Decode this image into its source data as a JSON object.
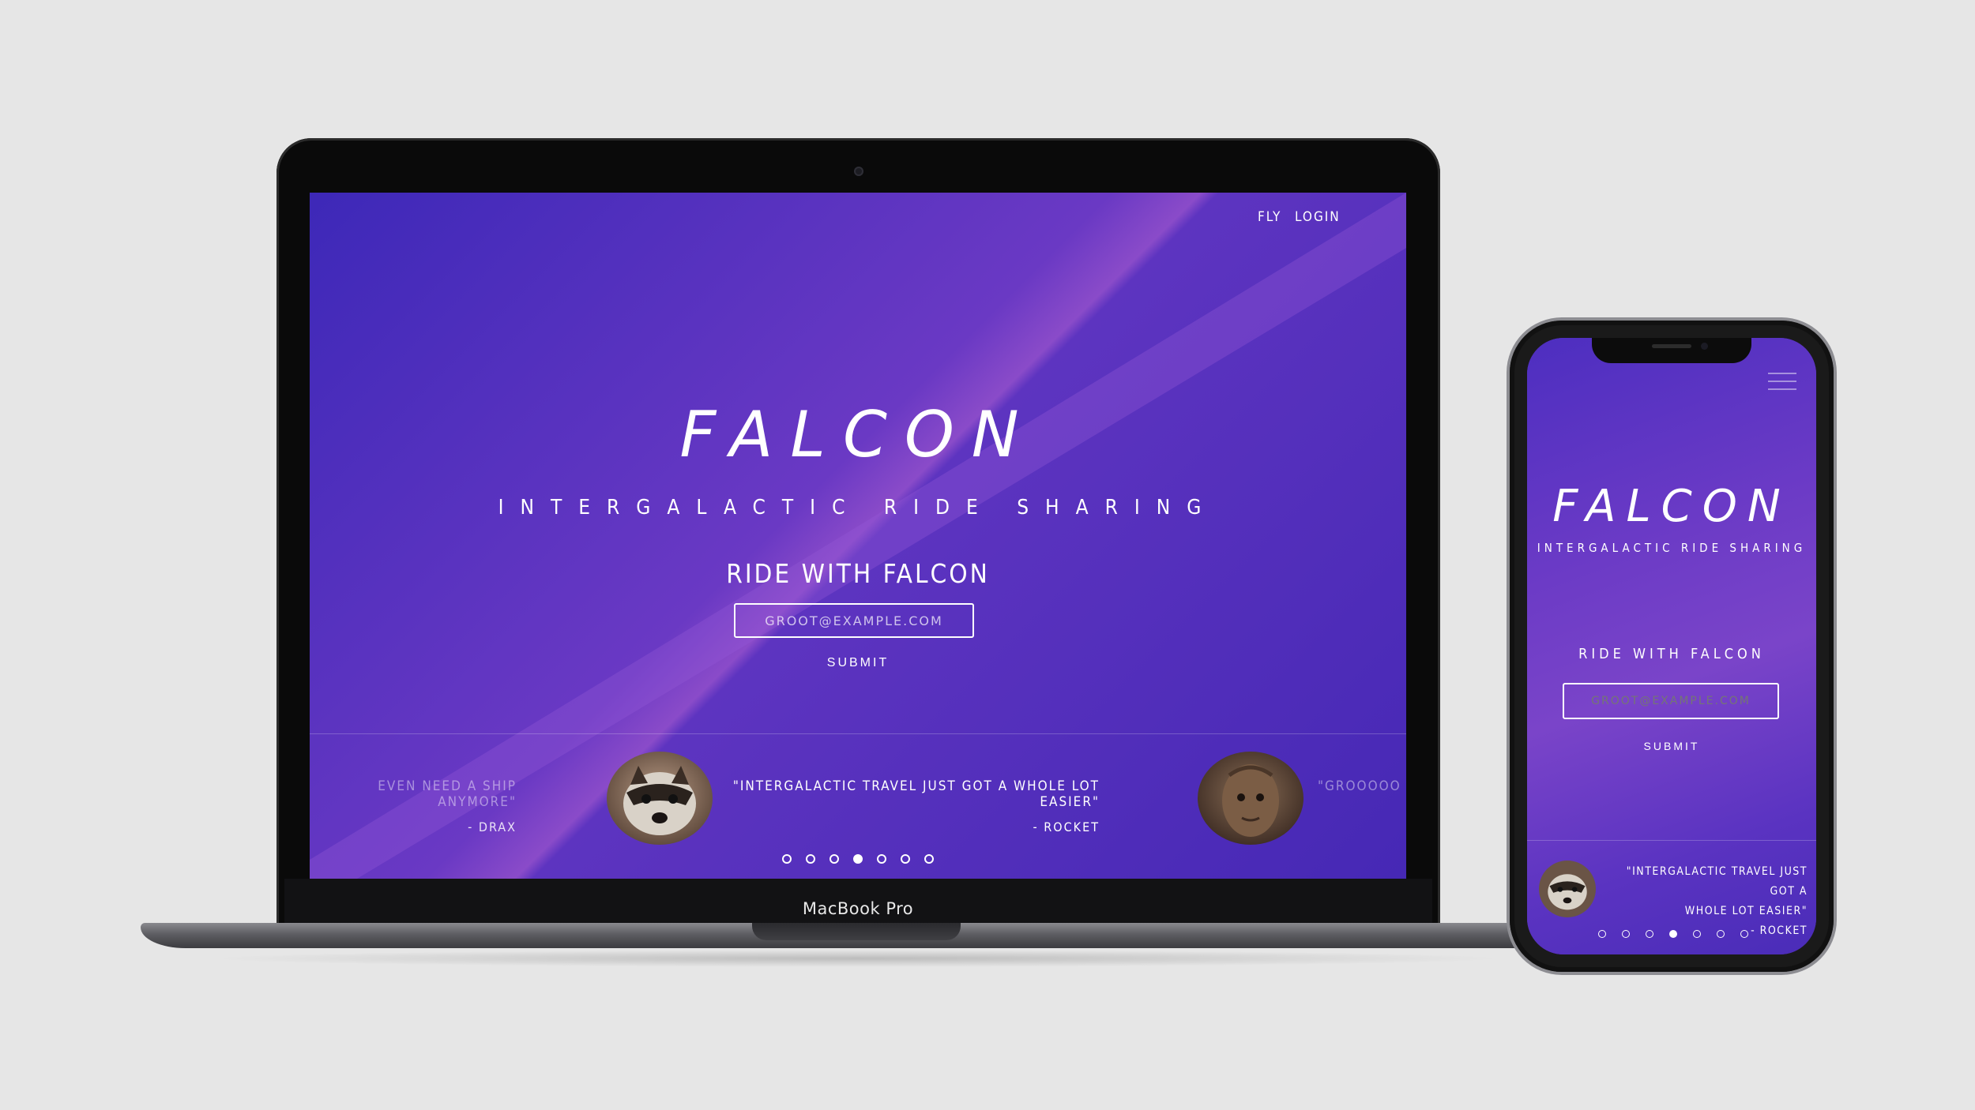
{
  "site": {
    "nav": {
      "fly": "FLY",
      "login": "LOGIN"
    },
    "title": "FALCON",
    "subtitle": "INTERGALACTIC RIDE SHARING",
    "cta_title": "RIDE WITH FALCON",
    "email_placeholder": "GROOT@EXAMPLE.COM",
    "submit": "SUBMIT",
    "testimonials": [
      {
        "quote": "EVEN NEED A SHIP ANYMORE\"",
        "author": "- DRAX"
      },
      {
        "quote": "\"INTERGALACTIC TRAVEL JUST GOT A WHOLE LOT EASIER\"",
        "author": "- ROCKET"
      },
      {
        "quote": "\"GROOOOO"
      }
    ],
    "mobile_quote_line1": "\"INTERGALACTIC TRAVEL JUST GOT A",
    "mobile_quote_line2": "WHOLE LOT EASIER\"",
    "mobile_author": "- ROCKET",
    "carousel": {
      "count": 7,
      "active_index": 3
    }
  },
  "device": {
    "laptop_label": "MacBook Pro"
  },
  "colors": {
    "background": "#e6e6e6",
    "gradient_dark": "#3d28b8",
    "gradient_light": "#8a4bc9",
    "text": "#ffffff"
  },
  "icons": [
    "hamburger-menu-icon"
  ]
}
